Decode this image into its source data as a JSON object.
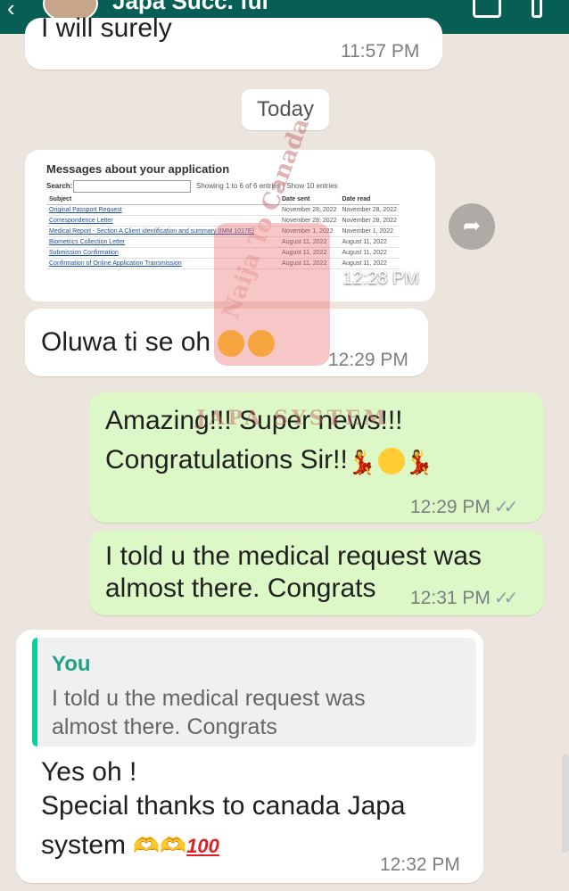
{
  "header": {
    "back_icon": "arrow-left-icon",
    "contact_name": "Japa Succ. ful",
    "icons": [
      "video-call-icon",
      "more-icon"
    ]
  },
  "messages": [
    {
      "type": "in",
      "text": "I will surely",
      "time": "11:57 PM"
    },
    {
      "type": "date",
      "text": "Today"
    },
    {
      "type": "image_in",
      "time": "12:28 PM",
      "image": {
        "title": "Messages about your application",
        "search_label": "Search:",
        "showing": "Showing 1 to 6 of 6 entries | Show 10 entries",
        "columns": [
          "Subject",
          "Date sent",
          "Date read"
        ],
        "rows": [
          [
            "Original Passport Request",
            "November 28, 2022",
            "November 28, 2022"
          ],
          [
            "Correspondence Letter",
            "November 28, 2022",
            "November 28, 2022"
          ],
          [
            "Medical Report - Section A Client identification and summary (IMM 1017E)",
            "November 1, 2022",
            "November 1, 2022"
          ],
          [
            "Biometrics Collection Letter",
            "August 11, 2022",
            "August 11, 2022"
          ],
          [
            "Submission Confirmation",
            "August 11, 2022",
            "August 11, 2022"
          ],
          [
            "Confirmation of Online Application Transmission",
            "August 11, 2022",
            "August 11, 2022"
          ]
        ]
      }
    },
    {
      "type": "in",
      "text": "Oluwa ti se oh",
      "time": "12:29 PM"
    },
    {
      "type": "out",
      "lines": [
        "Amazing!!! Super news!!!",
        "Congratulations Sir!!"
      ],
      "time": "12:29 PM"
    },
    {
      "type": "out",
      "lines": [
        "I told u the medical request was",
        "almost there. Congrats"
      ],
      "time": "12:31 PM"
    },
    {
      "type": "in_reply",
      "quote_author": "You",
      "quote_lines": [
        "I told u the medical request was",
        "almost there. Congrats"
      ],
      "lines": [
        "Yes oh !",
        "Special thanks to canada Japa",
        "system"
      ],
      "hundred": "100",
      "time": "12:32 PM"
    }
  ],
  "forward_icon": "forward-arrow-icon",
  "read_ticks": "✓✓",
  "watermark": {
    "line1": "Naija To Canada",
    "line2": "JAPA SYSTEM"
  }
}
